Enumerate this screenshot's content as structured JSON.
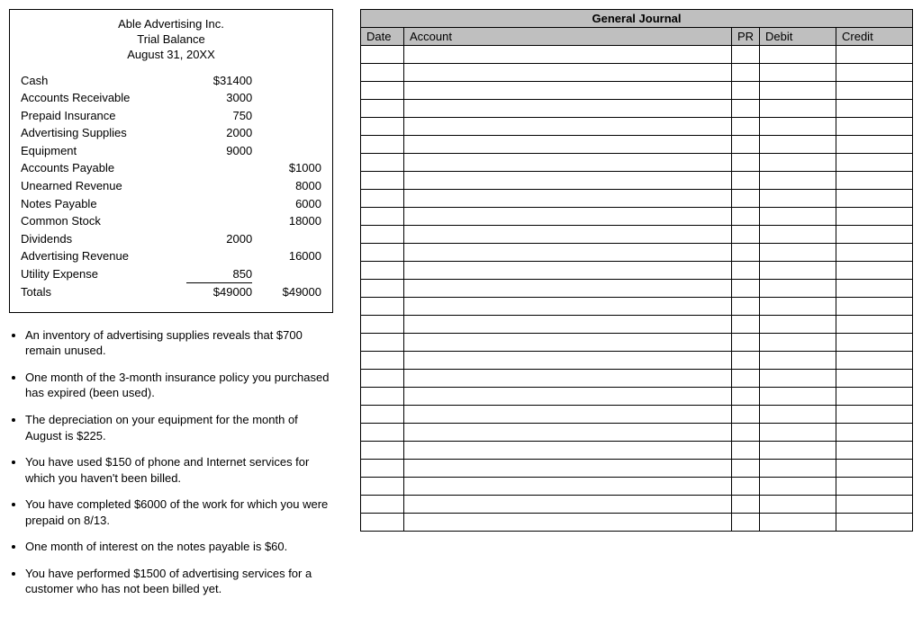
{
  "trial_balance": {
    "company": "Able Advertising Inc.",
    "title": "Trial Balance",
    "date": "August 31, 20XX",
    "rows": [
      {
        "name": "Cash",
        "debit": "$31400",
        "credit": ""
      },
      {
        "name": "Accounts Receivable",
        "debit": "3000",
        "credit": ""
      },
      {
        "name": "Prepaid Insurance",
        "debit": "750",
        "credit": ""
      },
      {
        "name": "Advertising Supplies",
        "debit": "2000",
        "credit": ""
      },
      {
        "name": "Equipment",
        "debit": "9000",
        "credit": ""
      },
      {
        "name": "Accounts Payable",
        "debit": "",
        "credit": "$1000"
      },
      {
        "name": "Unearned Revenue",
        "debit": "",
        "credit": "8000"
      },
      {
        "name": "Notes Payable",
        "debit": "",
        "credit": "6000"
      },
      {
        "name": "Common Stock",
        "debit": "",
        "credit": "18000"
      },
      {
        "name": "Dividends",
        "debit": "2000",
        "credit": ""
      },
      {
        "name": "Advertising Revenue",
        "debit": "",
        "credit": "16000"
      },
      {
        "name": "Utility Expense",
        "debit": "850",
        "credit": ""
      }
    ],
    "totals_label": "Totals",
    "totals_debit": "$49000",
    "totals_credit": "$49000"
  },
  "adjustments": [
    "An inventory of advertising supplies reveals that $700 remain unused.",
    "One month of the 3-month insurance policy you purchased has expired (been used).",
    "The depreciation on your equipment for the month of August is $225.",
    "You have used $150 of phone and Internet services for which you haven't been billed.",
    "You have completed $6000 of the work for which you were prepaid on 8/13.",
    "One month of interest on the notes payable is $60.",
    "You have performed $1500 of advertising services for a customer who has not been billed yet."
  ],
  "journal": {
    "title": "General Journal",
    "headers": {
      "date": "Date",
      "account": "Account",
      "pr": "PR",
      "debit": "Debit",
      "credit": "Credit"
    },
    "blank_rows": 27
  }
}
